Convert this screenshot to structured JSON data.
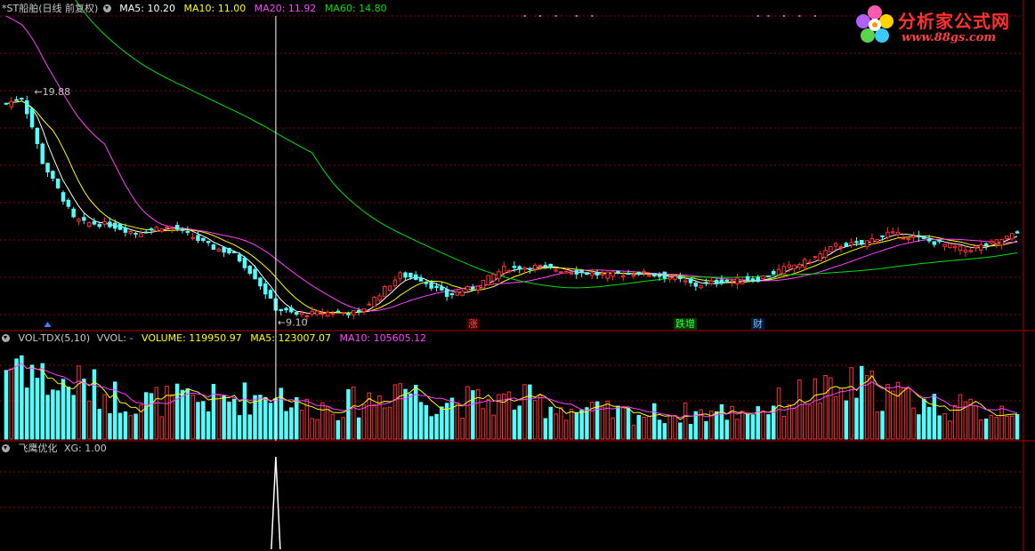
{
  "panel_main": {
    "title": "*ST船舶(日线 前复权)",
    "ma5": "MA5: 10.20",
    "ma10": "MA10: 11.00",
    "ma20": "MA20: 11.92",
    "ma60": "MA60: 14.80",
    "high_label": "19.88",
    "low_label": "9.10",
    "markers": [
      "涨",
      "跌增",
      "财"
    ]
  },
  "panel_volume": {
    "title": "VOL-TDX(5,10)",
    "vvol": "VVOL: -",
    "volume": "VOLUME: 119950.97",
    "ma5": "MA5: 123007.07",
    "ma10": "MA10: 105605.12"
  },
  "panel_xg": {
    "title": "飞鹰优化",
    "xg": "XG: 1.00"
  },
  "logo": {
    "title": "分析家公式网",
    "url": "www.88gs.com"
  },
  "colors": {
    "up": "#ff3030",
    "down": "#54fcfc",
    "ma5": "#ffffff",
    "ma10": "#ffff00",
    "ma20": "#ff40ff",
    "ma60": "#00e000",
    "grid": "#8b0000"
  },
  "chart_data": [
    {
      "type": "candlestick",
      "title": "*ST船舶(日线 前复权)",
      "n_bars": 196,
      "max_label": 19.88,
      "min_label": 9.1,
      "xg_signal_bar": 52,
      "ma_last": {
        "MA5": 10.2,
        "MA10": 11.0,
        "MA20": 11.92,
        "MA60": 14.8
      },
      "price_anchors": [
        [
          0,
          19.3
        ],
        [
          3,
          19.6
        ],
        [
          5,
          18.2
        ],
        [
          7,
          16.5
        ],
        [
          10,
          15.2
        ],
        [
          13,
          13.8
        ],
        [
          15,
          13.6
        ],
        [
          20,
          13.5
        ],
        [
          25,
          13.1
        ],
        [
          30,
          13.4
        ],
        [
          33,
          13.3
        ],
        [
          36,
          12.9
        ],
        [
          40,
          12.4
        ],
        [
          44,
          12.1
        ],
        [
          48,
          11.0
        ],
        [
          52,
          9.5
        ],
        [
          56,
          9.2
        ],
        [
          62,
          9.3
        ],
        [
          68,
          9.3
        ],
        [
          72,
          10.2
        ],
        [
          76,
          11.1
        ],
        [
          80,
          10.9
        ],
        [
          85,
          10.1
        ],
        [
          90,
          10.5
        ],
        [
          96,
          11.4
        ],
        [
          102,
          11.5
        ],
        [
          108,
          11.3
        ],
        [
          115,
          11.1
        ],
        [
          122,
          11.2
        ],
        [
          128,
          11.0
        ],
        [
          133,
          10.6
        ],
        [
          138,
          10.8
        ],
        [
          145,
          10.9
        ],
        [
          150,
          11.4
        ],
        [
          155,
          11.8
        ],
        [
          160,
          12.5
        ],
        [
          165,
          12.6
        ],
        [
          170,
          13.1
        ],
        [
          175,
          12.9
        ],
        [
          180,
          12.6
        ],
        [
          185,
          12.3
        ],
        [
          190,
          12.6
        ],
        [
          196,
          13.2
        ]
      ],
      "volume_anchors": [
        [
          0,
          215000
        ],
        [
          3,
          250000
        ],
        [
          6,
          190000
        ],
        [
          10,
          150000
        ],
        [
          13,
          170000
        ],
        [
          18,
          140000
        ],
        [
          25,
          110000
        ],
        [
          30,
          115000
        ],
        [
          40,
          115000
        ],
        [
          48,
          125000
        ],
        [
          52,
          150000
        ],
        [
          56,
          95000
        ],
        [
          65,
          100000
        ],
        [
          72,
          125000
        ],
        [
          76,
          170000
        ],
        [
          80,
          120000
        ],
        [
          90,
          110000
        ],
        [
          100,
          115000
        ],
        [
          110,
          85000
        ],
        [
          120,
          75000
        ],
        [
          130,
          75000
        ],
        [
          140,
          80000
        ],
        [
          148,
          100000
        ],
        [
          155,
          140000
        ],
        [
          160,
          130000
        ],
        [
          164,
          160000
        ],
        [
          170,
          135000
        ],
        [
          180,
          100000
        ],
        [
          190,
          80000
        ],
        [
          196,
          110000
        ]
      ],
      "xg_values": [
        0,
        1
      ]
    }
  ]
}
